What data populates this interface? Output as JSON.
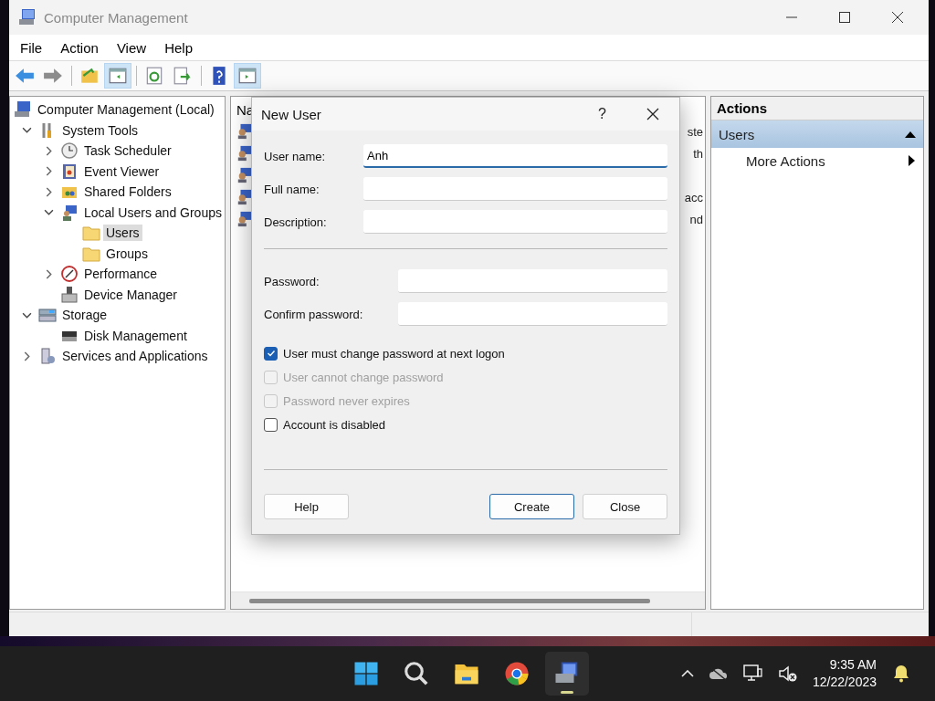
{
  "window": {
    "title": "Computer Management"
  },
  "menu": [
    "File",
    "Action",
    "View",
    "Help"
  ],
  "toolbar": [
    {
      "kind": "back",
      "disabled": false,
      "pressed": false
    },
    {
      "kind": "forward",
      "disabled": true,
      "pressed": false
    },
    {
      "kind": "up",
      "disabled": false,
      "pressed": false
    },
    {
      "kind": "tree",
      "disabled": false,
      "pressed": true
    },
    {
      "kind": "refresh",
      "disabled": false,
      "pressed": false
    },
    {
      "kind": "export",
      "disabled": false,
      "pressed": false
    },
    {
      "kind": "help",
      "disabled": false,
      "pressed": false
    },
    {
      "kind": "pane",
      "disabled": false,
      "pressed": true
    }
  ],
  "tree": [
    {
      "label": "Computer Management (Local)",
      "kind": "root",
      "selected": false,
      "children": [
        {
          "label": "System Tools",
          "kind": "branch",
          "expanded": true,
          "selected": false,
          "children": [
            {
              "label": "Task Scheduler",
              "kind": "branch",
              "expanded": false,
              "selected": false
            },
            {
              "label": "Event Viewer",
              "kind": "branch",
              "expanded": false,
              "selected": false
            },
            {
              "label": "Shared Folders",
              "kind": "branch",
              "expanded": false,
              "selected": false
            },
            {
              "label": "Local Users and Groups",
              "kind": "branch",
              "expanded": true,
              "selected": false,
              "children": [
                {
                  "label": "Users",
                  "kind": "leaf",
                  "selected": true
                },
                {
                  "label": "Groups",
                  "kind": "leaf",
                  "selected": false
                }
              ]
            },
            {
              "label": "Performance",
              "kind": "branch",
              "expanded": false,
              "selected": false
            },
            {
              "label": "Device Manager",
              "kind": "leaf",
              "selected": false
            }
          ]
        },
        {
          "label": "Storage",
          "kind": "branch",
          "expanded": true,
          "selected": false,
          "children": [
            {
              "label": "Disk Management",
              "kind": "leaf",
              "selected": false
            }
          ]
        },
        {
          "label": "Services and Applications",
          "kind": "branch",
          "expanded": false,
          "selected": false
        }
      ]
    }
  ],
  "list": {
    "column_1": "Na",
    "rows": [
      {
        "column_2": "ste"
      },
      {
        "column_2": "th"
      },
      {},
      {
        "column_2": "acc"
      },
      {
        "column_2": "nd"
      }
    ]
  },
  "actions": {
    "title": "Actions",
    "section": {
      "label": "Users",
      "expanded": true
    },
    "items": [
      "More Actions"
    ]
  },
  "dialog": {
    "title": "New User",
    "help": "?",
    "account_fields": [
      {
        "label": "User name:",
        "value": "Anh ",
        "focused": true
      },
      {
        "label": "Full name:",
        "focused": false
      },
      {
        "label": "Description:",
        "focused": false
      }
    ],
    "password_fields": [
      {
        "label": "Password:",
        "focused": false
      },
      {
        "label": "Confirm password:",
        "focused": false
      }
    ],
    "options": [
      {
        "label": "User must change password at next logon",
        "checked": true,
        "disabled": false
      },
      {
        "label": "User cannot change password",
        "checked": false,
        "disabled": true
      },
      {
        "label": "Password never expires",
        "checked": false,
        "disabled": true
      },
      {
        "label": "Account is disabled",
        "checked": false,
        "disabled": false
      }
    ],
    "buttons": [
      {
        "label": "Help",
        "default": false
      },
      {
        "label": "Create",
        "default": true
      },
      {
        "label": "Close",
        "default": false
      }
    ]
  },
  "taskbar": {
    "apps": [
      {
        "kind": "start",
        "selected": false
      },
      {
        "kind": "search",
        "selected": false
      },
      {
        "kind": "files",
        "selected": false
      },
      {
        "kind": "browser",
        "selected": false
      },
      {
        "kind": "management",
        "selected": true
      }
    ],
    "time": "9:35 AM",
    "date": "12/22/2023"
  }
}
